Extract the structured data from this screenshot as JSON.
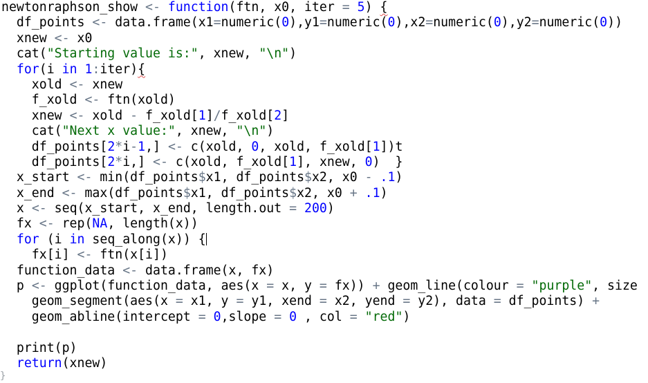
{
  "editor": {
    "language": "R",
    "lines": [
      [
        [
          "plain",
          "newtonraphson_show "
        ],
        [
          "op",
          "<-"
        ],
        [
          "plain",
          " "
        ],
        [
          "kw",
          "function"
        ],
        [
          "plain",
          "(ftn, x0, iter "
        ],
        [
          "op",
          "="
        ],
        [
          "plain",
          " "
        ],
        [
          "num",
          "5"
        ],
        [
          "plain",
          ") "
        ],
        [
          "sq",
          "{"
        ]
      ],
      [
        [
          "plain",
          "  df_points "
        ],
        [
          "op",
          "<-"
        ],
        [
          "plain",
          " data.frame(x1"
        ],
        [
          "op",
          "="
        ],
        [
          "plain",
          "numeric("
        ],
        [
          "num",
          "0"
        ],
        [
          "plain",
          "),y1"
        ],
        [
          "op",
          "="
        ],
        [
          "plain",
          "numeric("
        ],
        [
          "num",
          "0"
        ],
        [
          "plain",
          "),x2"
        ],
        [
          "op",
          "="
        ],
        [
          "plain",
          "numeric("
        ],
        [
          "num",
          "0"
        ],
        [
          "plain",
          "),y2"
        ],
        [
          "op",
          "="
        ],
        [
          "plain",
          "numeric("
        ],
        [
          "num",
          "0"
        ],
        [
          "plain",
          "))"
        ]
      ],
      [
        [
          "plain",
          "  xnew "
        ],
        [
          "op",
          "<-"
        ],
        [
          "plain",
          " x0"
        ]
      ],
      [
        [
          "plain",
          "  cat("
        ],
        [
          "str",
          "\"Starting value is:\""
        ],
        [
          "plain",
          ", xnew, "
        ],
        [
          "str",
          "\"\\n\""
        ],
        [
          "plain",
          ")"
        ]
      ],
      [
        [
          "plain",
          "  "
        ],
        [
          "kw",
          "for"
        ],
        [
          "plain",
          "(i "
        ],
        [
          "kw",
          "in"
        ],
        [
          "plain",
          " "
        ],
        [
          "num",
          "1"
        ],
        [
          "op",
          ":"
        ],
        [
          "plain",
          "iter)"
        ],
        [
          "sq",
          "{"
        ]
      ],
      [
        [
          "plain",
          "    xold "
        ],
        [
          "op",
          "<-"
        ],
        [
          "plain",
          " xnew"
        ]
      ],
      [
        [
          "plain",
          "    f_xold "
        ],
        [
          "op",
          "<-"
        ],
        [
          "plain",
          " ftn(xold)"
        ]
      ],
      [
        [
          "plain",
          "    xnew "
        ],
        [
          "op",
          "<-"
        ],
        [
          "plain",
          " xold "
        ],
        [
          "op",
          "-"
        ],
        [
          "plain",
          " f_xold["
        ],
        [
          "num",
          "1"
        ],
        [
          "plain",
          "]"
        ],
        [
          "op",
          "/"
        ],
        [
          "plain",
          "f_xold["
        ],
        [
          "num",
          "2"
        ],
        [
          "plain",
          "]"
        ]
      ],
      [
        [
          "plain",
          "    cat("
        ],
        [
          "str",
          "\"Next x value:\""
        ],
        [
          "plain",
          ", xnew, "
        ],
        [
          "str",
          "\"\\n\""
        ],
        [
          "plain",
          ")"
        ]
      ],
      [
        [
          "plain",
          "    df_points["
        ],
        [
          "num",
          "2"
        ],
        [
          "op",
          "*"
        ],
        [
          "plain",
          "i"
        ],
        [
          "op",
          "-"
        ],
        [
          "num",
          "1"
        ],
        [
          "plain",
          ",] "
        ],
        [
          "op",
          "<-"
        ],
        [
          "plain",
          " c(xold, "
        ],
        [
          "num",
          "0"
        ],
        [
          "plain",
          ", xold, f_xold["
        ],
        [
          "num",
          "1"
        ],
        [
          "plain",
          "])t"
        ]
      ],
      [
        [
          "plain",
          "    df_points["
        ],
        [
          "num",
          "2"
        ],
        [
          "op",
          "*"
        ],
        [
          "plain",
          "i,] "
        ],
        [
          "op",
          "<-"
        ],
        [
          "plain",
          " c(xold, f_xold["
        ],
        [
          "num",
          "1"
        ],
        [
          "plain",
          "], xnew, "
        ],
        [
          "num",
          "0"
        ],
        [
          "plain",
          ")  }"
        ]
      ],
      [
        [
          "plain",
          "  x_start "
        ],
        [
          "op",
          "<-"
        ],
        [
          "plain",
          " min(df_points"
        ],
        [
          "op",
          "$"
        ],
        [
          "plain",
          "x1, df_points"
        ],
        [
          "op",
          "$"
        ],
        [
          "plain",
          "x2, x0 "
        ],
        [
          "op",
          "-"
        ],
        [
          "plain",
          " "
        ],
        [
          "num",
          ".1"
        ],
        [
          "plain",
          ")"
        ]
      ],
      [
        [
          "plain",
          "  x_end "
        ],
        [
          "op",
          "<-"
        ],
        [
          "plain",
          " max(df_points"
        ],
        [
          "op",
          "$"
        ],
        [
          "plain",
          "x1, df_points"
        ],
        [
          "op",
          "$"
        ],
        [
          "plain",
          "x2, x0 "
        ],
        [
          "op",
          "+"
        ],
        [
          "plain",
          " "
        ],
        [
          "num",
          ".1"
        ],
        [
          "plain",
          ")"
        ]
      ],
      [
        [
          "plain",
          "  x "
        ],
        [
          "op",
          "<-"
        ],
        [
          "plain",
          " seq(x_start, x_end, length.out "
        ],
        [
          "op",
          "="
        ],
        [
          "plain",
          " "
        ],
        [
          "num",
          "200"
        ],
        [
          "plain",
          ")"
        ]
      ],
      [
        [
          "plain",
          "  fx "
        ],
        [
          "op",
          "<-"
        ],
        [
          "plain",
          " rep("
        ],
        [
          "num",
          "NA"
        ],
        [
          "plain",
          ", length(x))"
        ]
      ],
      [
        [
          "plain",
          "  "
        ],
        [
          "kw",
          "for"
        ],
        [
          "plain",
          " (i "
        ],
        [
          "kw",
          "in"
        ],
        [
          "plain",
          " seq_along(x)) {"
        ],
        [
          "cursor",
          ""
        ]
      ],
      [
        [
          "plain",
          "    fx[i] "
        ],
        [
          "op",
          "<-"
        ],
        [
          "plain",
          " ftn(x[i])"
        ]
      ],
      [
        [
          "plain",
          "  function_data "
        ],
        [
          "op",
          "<-"
        ],
        [
          "plain",
          " data.frame(x, fx)"
        ]
      ],
      [
        [
          "plain",
          "  p "
        ],
        [
          "op",
          "<-"
        ],
        [
          "plain",
          " ggplot(function_data, aes(x "
        ],
        [
          "op",
          "="
        ],
        [
          "plain",
          " x, y "
        ],
        [
          "op",
          "="
        ],
        [
          "plain",
          " fx)) "
        ],
        [
          "op",
          "+"
        ],
        [
          "plain",
          " geom_line(colour "
        ],
        [
          "op",
          "="
        ],
        [
          "plain",
          " "
        ],
        [
          "str",
          "\"purple\""
        ],
        [
          "plain",
          ", size "
        ]
      ],
      [
        [
          "plain",
          "    geom_segment(aes(x "
        ],
        [
          "op",
          "="
        ],
        [
          "plain",
          " x1, y "
        ],
        [
          "op",
          "="
        ],
        [
          "plain",
          " y1, xend "
        ],
        [
          "op",
          "="
        ],
        [
          "plain",
          " x2, yend "
        ],
        [
          "op",
          "="
        ],
        [
          "plain",
          " y2), data "
        ],
        [
          "op",
          "="
        ],
        [
          "plain",
          " df_points) "
        ],
        [
          "op",
          "+"
        ]
      ],
      [
        [
          "plain",
          "    geom_abline(intercept "
        ],
        [
          "op",
          "="
        ],
        [
          "plain",
          " "
        ],
        [
          "num",
          "0"
        ],
        [
          "plain",
          ",slope "
        ],
        [
          "op",
          "="
        ],
        [
          "plain",
          " "
        ],
        [
          "num",
          "0"
        ],
        [
          "plain",
          " , col "
        ],
        [
          "op",
          "="
        ],
        [
          "plain",
          " "
        ],
        [
          "str",
          "\"red\""
        ],
        [
          "plain",
          ")"
        ]
      ],
      [],
      [
        [
          "plain",
          "  print(p)"
        ]
      ],
      [
        [
          "plain",
          "  "
        ],
        [
          "kw",
          "return"
        ],
        [
          "plain",
          "(xnew)"
        ]
      ]
    ],
    "fold_marker": "}"
  }
}
